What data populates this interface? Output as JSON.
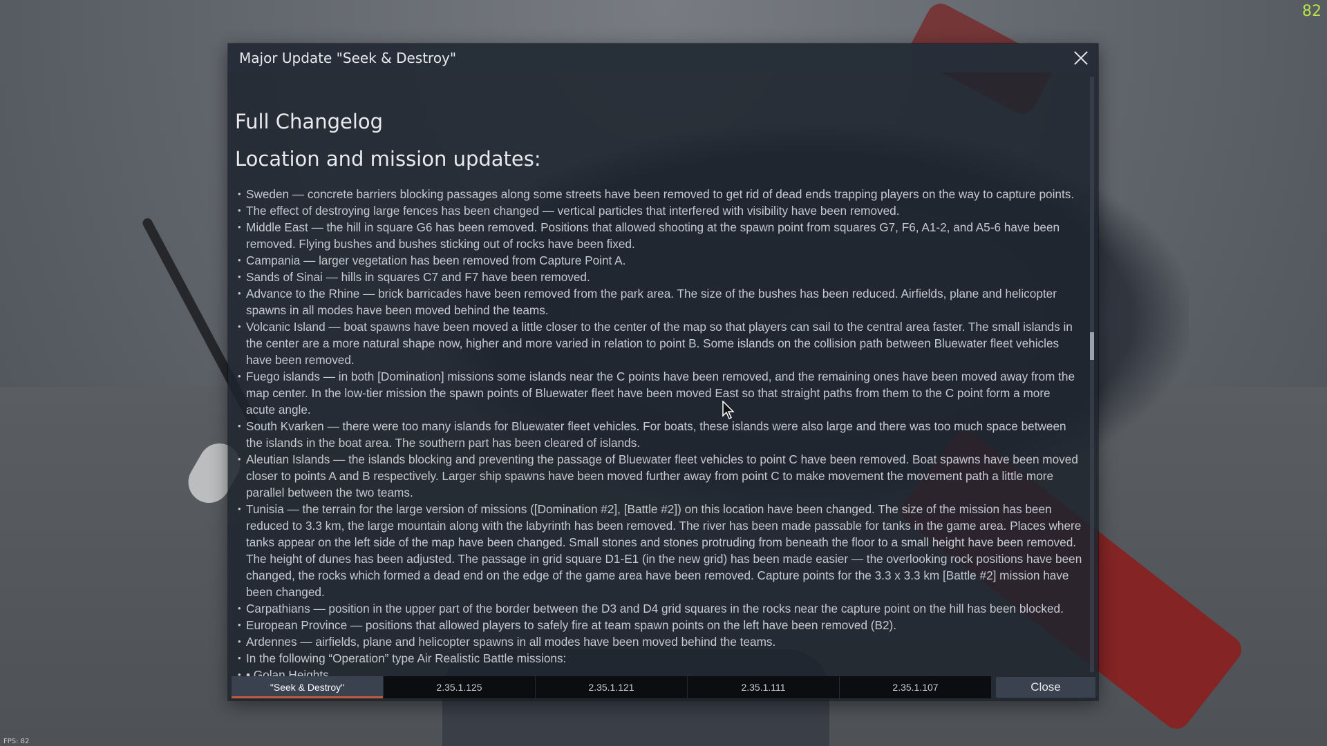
{
  "hud": {
    "fps_corner": "82",
    "fps_bottom": "FPS: 82"
  },
  "dialog": {
    "title": "Major Update \"Seek & Destroy\"",
    "heading": "Full Changelog",
    "subheading": "Location and mission updates:",
    "items": [
      "Sweden — concrete barriers blocking passages along some streets have been removed to get rid of dead ends trapping players on the way to capture points.",
      "The effect of destroying large fences has been changed — vertical particles that interfered with visibility have been removed.",
      "Middle East — the hill in square G6 has been removed. Positions that allowed shooting at the spawn point from squares G7, F6, A1-2, and A5-6 have been removed. Flying bushes and bushes sticking out of rocks have been fixed.",
      "Campania — larger vegetation has been removed from Capture Point A.",
      "Sands of Sinai — hills in squares C7 and F7 have been removed.",
      "Advance to the Rhine — brick barricades have been removed from the park area. The size of the bushes has been reduced. Airfields, plane and helicopter spawns in all modes have been moved behind the teams.",
      "Volcanic Island — boat spawns have been moved a little closer to the center of the map so that players can sail to the central area faster. The small islands in the center are a more natural shape now, higher and more varied in relation to point B. Some islands on the collision path between Bluewater fleet vehicles have been removed.",
      "Fuego islands — in both [Domination] missions some islands near the C points have been removed, and the remaining ones have been moved away from the map center. In the low-tier mission the spawn points of Bluewater fleet have been moved East so that straight paths from them to the C point form a more acute angle.",
      "South Kvarken — there were too many islands for Bluewater fleet vehicles. For boats, these islands were also large and there was too much space between the islands in the boat area. The southern part has been cleared of islands.",
      "Aleutian Islands — the islands blocking and preventing the passage of Bluewater fleet vehicles to point C have been removed. Boat spawns have been moved closer to points A and B respectively. Larger ship spawns have been moved further away from point C to make movement the movement path a little more parallel between the two teams.",
      "Tunisia — the terrain for the large version of missions ([Domination #2], [Battle #2]) on this location have been changed. The size of the mission has been reduced to 3.3 km, the large mountain along with the labyrinth has been removed. The river has been made passable for tanks in the game area. Places where tanks appear on the left side of the map have been changed. Small stones and stones protruding from beneath the floor to a small height have been removed. The height of dunes has been adjusted. The passage in grid square D1-E1 (in the new grid) has been made easier — the overlooking rock positions have been changed, the rocks which formed a dead end on the edge of the game area have been removed. Capture points for the 3.3 x 3.3 km [Battle #2] mission have been changed.",
      "Carpathians — position in the upper part of the border between the D3 and D4 grid squares in the rocks near the capture point on the hill has been blocked.",
      "European Province — positions that allowed players to safely fire at team spawn points on the left have been removed (B2).",
      "Ardennes — airfields, plane and helicopter spawns in all modes have been moved behind the teams.",
      "In the following “Operation” type Air Realistic Battle missions:",
      "• Golan Heights,"
    ],
    "tabs": [
      "\"Seek & Destroy\"",
      "2.35.1.125",
      "2.35.1.121",
      "2.35.1.111",
      "2.35.1.107"
    ],
    "close_button": "Close"
  }
}
